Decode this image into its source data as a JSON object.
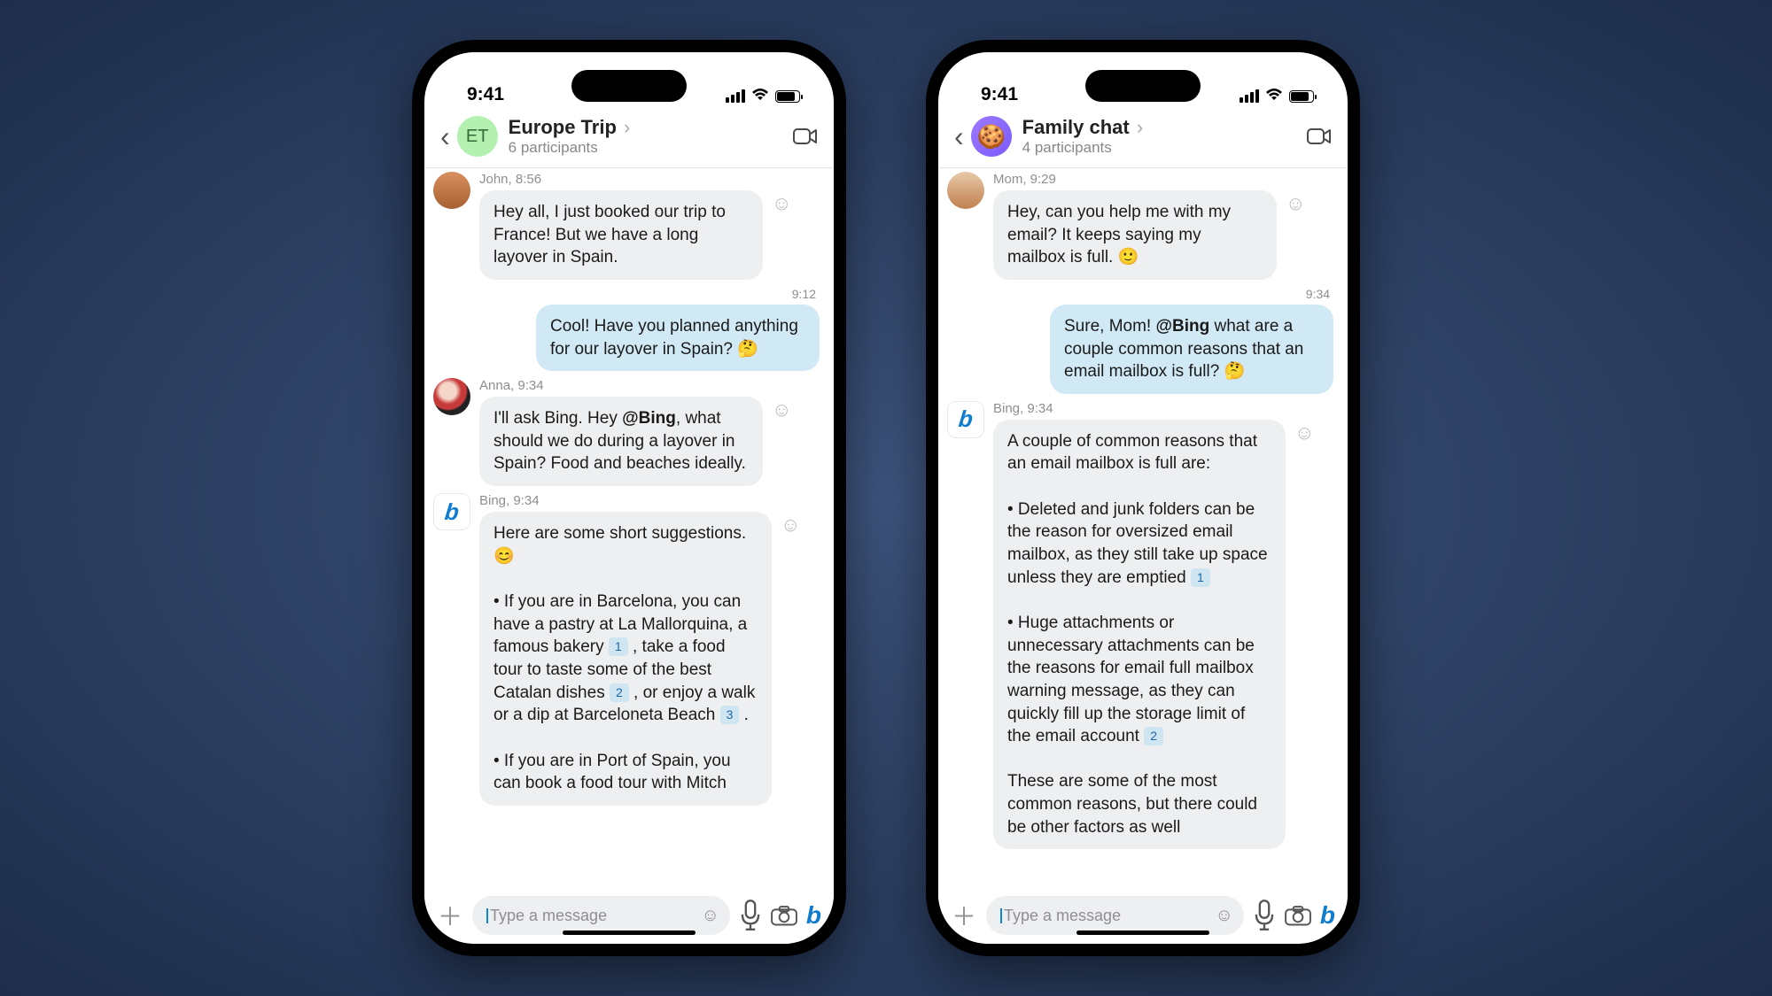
{
  "status": {
    "time": "9:41"
  },
  "left": {
    "header": {
      "title": "Europe Trip",
      "subtitle": "6 participants",
      "avatar_text": "ET"
    },
    "msg1": {
      "meta": "John, 8:56",
      "text": "Hey all, I just booked our trip to France! But we have a long layover in Spain."
    },
    "out1": {
      "time": "9:12",
      "text": "Cool! Have you planned anything for our layover in Spain? 🤔"
    },
    "msg2": {
      "meta": "Anna, 9:34",
      "text_pre": "I'll ask Bing. Hey ",
      "mention": "@Bing",
      "text_post": ", what should we do during a layover in Spain? Food and beaches ideally."
    },
    "msg3": {
      "meta": "Bing, 9:34",
      "intro": "Here are some short suggestions. 😊",
      "p1a": "• If you are in Barcelona, you can have a pastry at La Mallorquina, a famous bakery ",
      "p1b": " , take a food tour to taste some of the best Catalan dishes ",
      "p1c": " , or enjoy a walk or a dip at Barceloneta Beach ",
      "p1d": " .",
      "p2": "• If you are in Port of Spain, you can book a food tour with Mitch"
    },
    "input_placeholder": "Type a message"
  },
  "right": {
    "header": {
      "title": "Family chat",
      "subtitle": "4 participants"
    },
    "msg1": {
      "meta": "Mom, 9:29",
      "text": "Hey, can you help me with my email? It keeps saying my mailbox is full. 🙂"
    },
    "out1": {
      "time": "9:34",
      "text_pre": "Sure, Mom! ",
      "mention": "@Bing",
      "text_post": " what are a couple common reasons that an email mailbox is full? 🤔"
    },
    "msg2": {
      "meta": "Bing, 9:34",
      "intro": "A couple of common reasons that an email mailbox is full are:",
      "p1": "• Deleted and junk folders can be the reason for oversized email mailbox, as they still take up space unless they are emptied ",
      "p2": "• Huge attachments or unnecessary attachments can be the reasons for email full mailbox warning message, as they can quickly fill up the storage limit of the email account ",
      "p3": "These are some of the most common reasons, but there could be other factors as well"
    },
    "input_placeholder": "Type a message"
  },
  "citations": {
    "c1": "1",
    "c2": "2",
    "c3": "3"
  }
}
